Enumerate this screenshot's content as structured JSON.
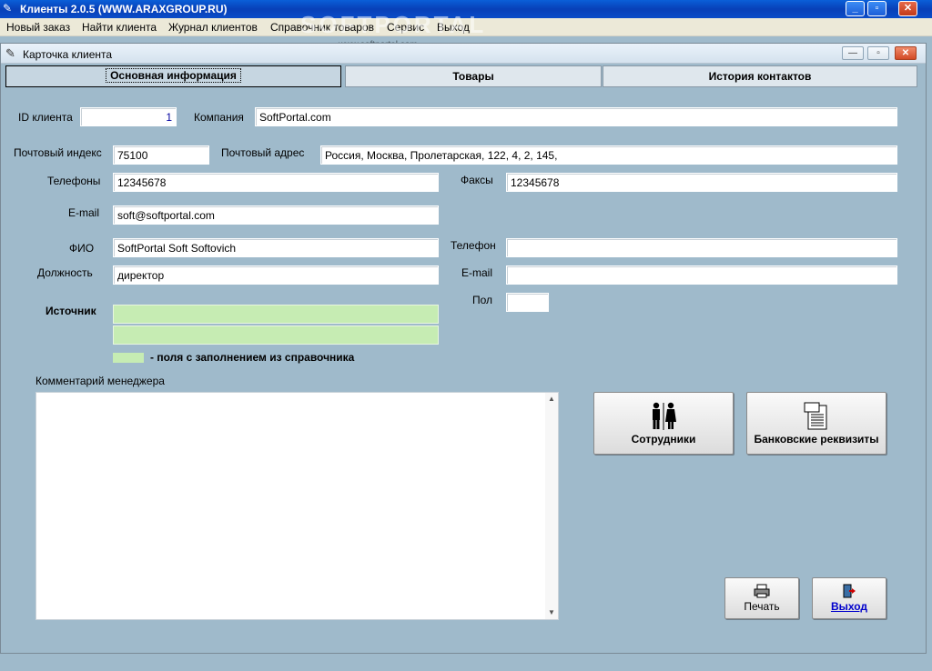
{
  "app": {
    "title": "Клиенты 2.0.5 (WWW.ARAXGROUP.RU)",
    "watermark": "SOFTPORTAL",
    "watermark_url": "www.softportal.com"
  },
  "menu": [
    "Новый заказ",
    "Найти клиента",
    "Журнал клиентов",
    "Справочник товаров",
    "Сервис",
    "Выход"
  ],
  "window": {
    "title": "Карточка клиента"
  },
  "tabs": [
    {
      "label": "Основная информация",
      "active": true
    },
    {
      "label": "Товары",
      "active": false
    },
    {
      "label": "История контактов",
      "active": false
    }
  ],
  "form": {
    "id_label": "ID клиента",
    "id_value": "1",
    "company_label": "Компания",
    "company_value": "SoftPortal.com",
    "zip_label": "Почтовый индекс",
    "zip_value": "75100",
    "address_label": "Почтовый адрес",
    "address_value": "Россия, Москва, Пролетарская, 122, 4, 2, 145,",
    "phones_label": "Телефоны",
    "phones_value": "12345678",
    "faxes_label": "Факсы",
    "faxes_value": "12345678",
    "email_label": "E-mail",
    "email_value": "soft@softportal.com",
    "fio_label": "ФИО",
    "fio_value": "SoftPortal Soft Softovich",
    "phone_label": "Телефон",
    "phone_value": "",
    "position_label": "Должность",
    "position_value": "директор",
    "email2_label": "E-mail",
    "email2_value": "",
    "gender_label": "Пол",
    "gender_value": "",
    "source_label": "Источник",
    "source_value1": "",
    "source_value2": "",
    "legend_text": "- поля с заполнением из справочника",
    "comment_label": "Комментарий менеджера",
    "comment_value": ""
  },
  "buttons": {
    "staff": "Сотрудники",
    "bank": "Банковские реквизиты",
    "print": "Печать",
    "exit": "Выход"
  },
  "colors": {
    "background": "#9fbacb",
    "directory_field": "#c6ecb3",
    "titlebar": "#0a4cc8"
  }
}
